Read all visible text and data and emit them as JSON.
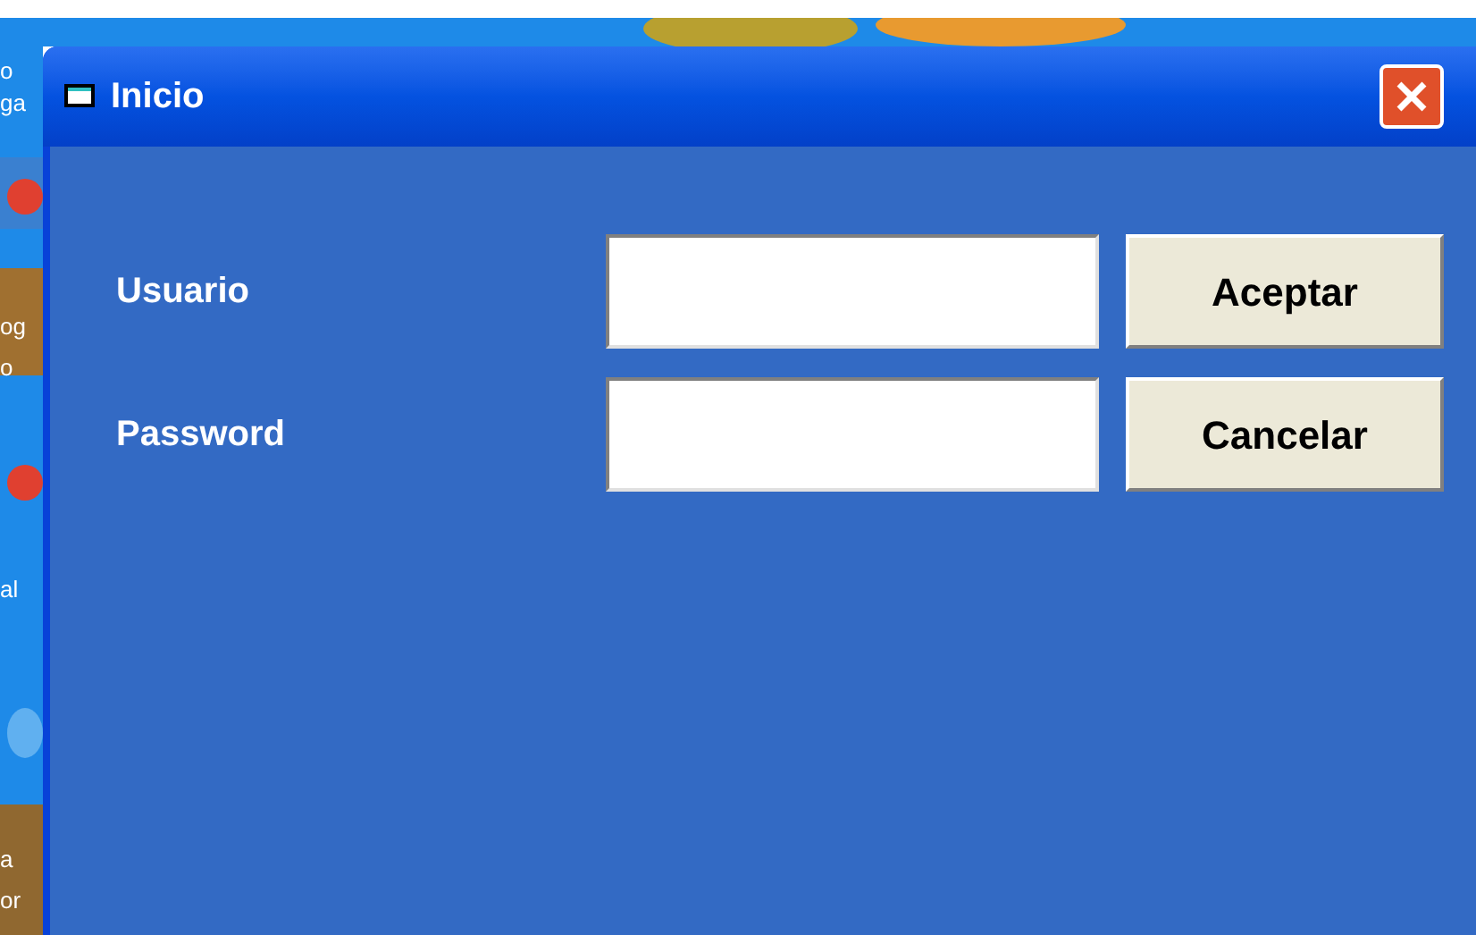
{
  "desktop": {
    "icon_labels": [
      "o",
      "ga",
      "og",
      "o",
      "al",
      "a",
      "or"
    ]
  },
  "window": {
    "title": "Inicio"
  },
  "fields": [
    {
      "label": "Usuario"
    },
    {
      "label": "Password"
    }
  ],
  "buttons": [
    "Aceptar",
    "Cancelar"
  ]
}
